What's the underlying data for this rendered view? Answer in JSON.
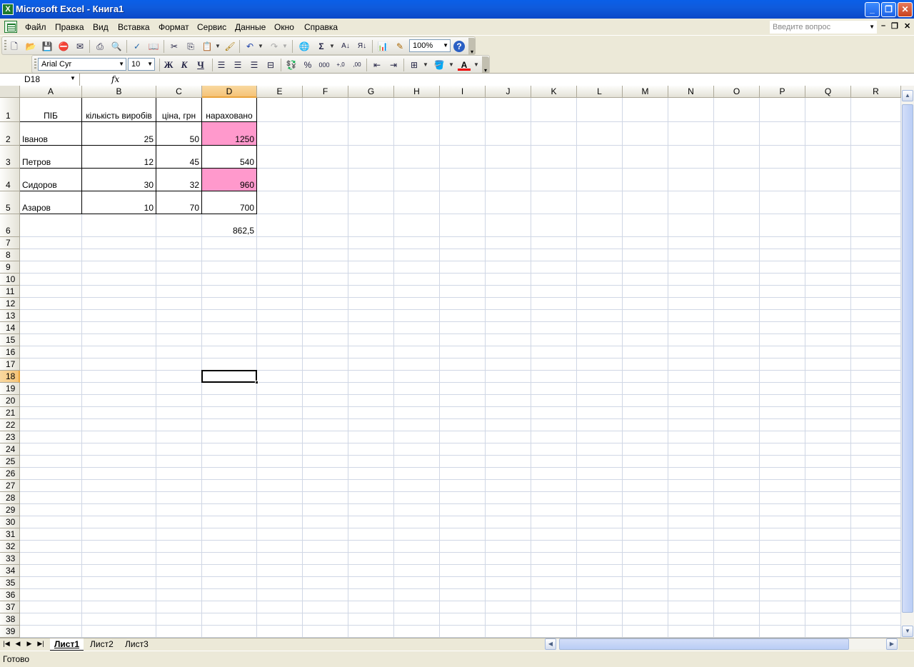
{
  "window": {
    "title": "Microsoft Excel - Книга1"
  },
  "menu": {
    "items": [
      "Файл",
      "Правка",
      "Вид",
      "Вставка",
      "Формат",
      "Сервис",
      "Данные",
      "Окно",
      "Справка"
    ],
    "ask_placeholder": "Введите вопрос"
  },
  "toolbar": {
    "zoom": "100%",
    "font": "Arial Cyr",
    "size": "10",
    "bold": "Ж",
    "italic": "К",
    "underline": "Ч"
  },
  "formula_bar": {
    "name_box": "D18",
    "fx": "fx",
    "content": ""
  },
  "columns": [
    "A",
    "B",
    "C",
    "D",
    "E",
    "F",
    "G",
    "H",
    "I",
    "J",
    "K",
    "L",
    "M",
    "N",
    "O",
    "P",
    "Q",
    "R"
  ],
  "selected": {
    "column": "D",
    "row": 18
  },
  "table": {
    "headers": [
      "ПІБ",
      "кількість виробів",
      "ціна, грн",
      "нараховано"
    ],
    "rows": [
      {
        "name": "Іванов",
        "qty": "25",
        "price": "50",
        "total": "1250",
        "highlight": true
      },
      {
        "name": "Петров",
        "qty": "12",
        "price": "45",
        "total": "540",
        "highlight": false
      },
      {
        "name": "Сидоров",
        "qty": "30",
        "price": "32",
        "total": "960",
        "highlight": true
      },
      {
        "name": "Азаров",
        "qty": "10",
        "price": "70",
        "total": "700",
        "highlight": false
      }
    ],
    "average": "862,5"
  },
  "highlight_color": "#ff99cc",
  "sheets": [
    "Лист1",
    "Лист2",
    "Лист3"
  ],
  "active_sheet": "Лист1",
  "status": "Готово"
}
